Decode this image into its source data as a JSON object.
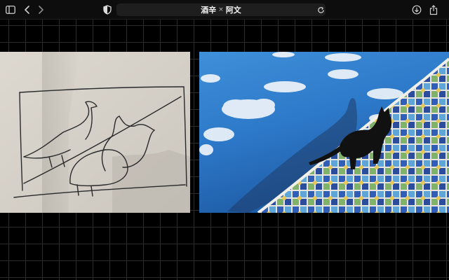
{
  "browser": {
    "title_left": "酒辛",
    "title_separator": "×",
    "title_right": "阿文",
    "icons": [
      "sidebar-icon",
      "back-icon",
      "forward-icon",
      "shield-icon",
      "reload-icon",
      "download-icon",
      "share-icon"
    ]
  },
  "colors": {
    "background": "#000000",
    "grid": "#2b2b2b",
    "paper": "#d9d4cc",
    "water": "#2d79c9",
    "tile_blue": "#2f5fb8"
  }
}
